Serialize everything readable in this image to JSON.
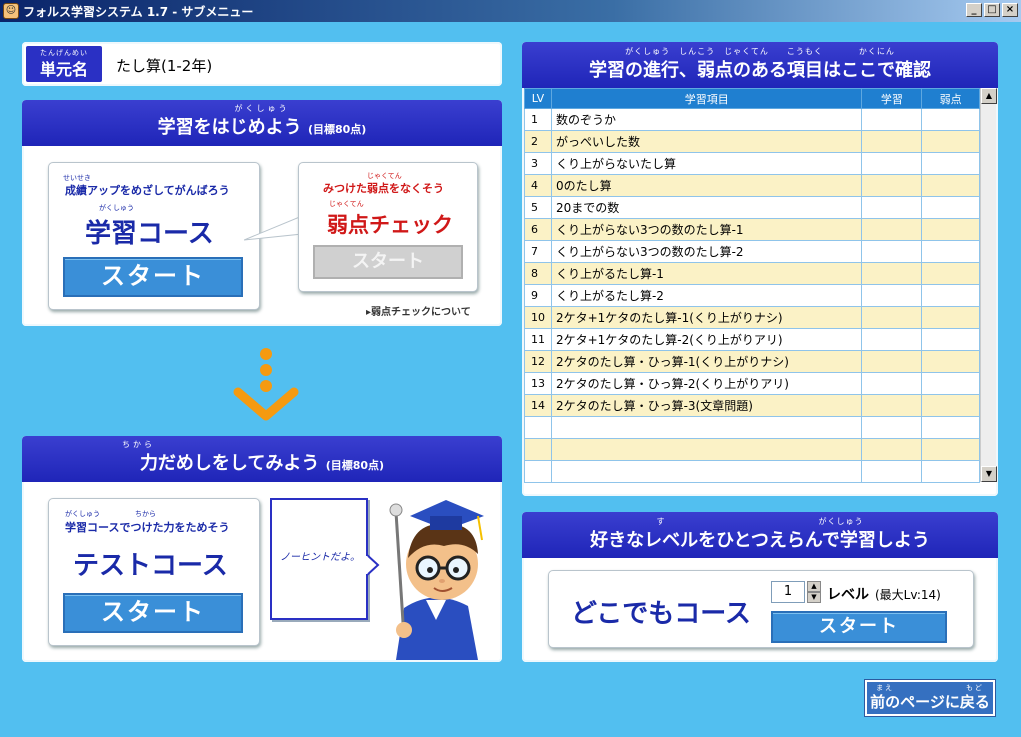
{
  "window": {
    "title": "フォルス学習システム 1.7 - サブメニュー",
    "minimize": "_",
    "maximize": "□",
    "close": "×"
  },
  "unit": {
    "label_ruby": "たんげんめい",
    "label": "単元名",
    "value": "たし算(1-2年)"
  },
  "study": {
    "title_ruby": "がくしゅう",
    "title": "学習をはじめよう",
    "title_sub": "(目標80点)",
    "course_sub_ruby": "せいせき",
    "course_sub": "成績アップをめざしてがんばろう",
    "course_ruby": "がくしゅう",
    "course_title": "学習コース",
    "course_start": "スタート",
    "weak_sub_ruby": "じゃくてん",
    "weak_sub": "みつけた弱点をなくそう",
    "weak_ruby": "じゃくてん",
    "weak_title": "弱点チェック",
    "weak_start": "スタート",
    "weak_link": "弱点チェックについて"
  },
  "test": {
    "title_ruby": "ちから",
    "title": "力だめしをしてみよう",
    "title_sub": "(目標80点)",
    "sub_ruby": "がくしゅう　　　　　ちから",
    "sub": "学習コースでつけた力をためそう",
    "course_title": "テストコース",
    "start": "スタート",
    "bubble": "ノーヒントだよ。"
  },
  "progress": {
    "title_ruby": "がくしゅう　しんこう　じゃくてん　　こうもく　　　　かくにん",
    "title": "学習の進行、弱点のある項目はここで確認",
    "headers": [
      "LV",
      "学習項目",
      "学習",
      "弱点"
    ],
    "rows": [
      [
        "1",
        "数のぞうか",
        "",
        ""
      ],
      [
        "2",
        "がっぺいした数",
        "",
        ""
      ],
      [
        "3",
        "くり上がらないたし算",
        "",
        ""
      ],
      [
        "4",
        "0のたし算",
        "",
        ""
      ],
      [
        "5",
        "20までの数",
        "",
        ""
      ],
      [
        "6",
        "くり上がらない3つの数のたし算-1",
        "",
        ""
      ],
      [
        "7",
        "くり上がらない3つの数のたし算-2",
        "",
        ""
      ],
      [
        "8",
        "くり上がるたし算-1",
        "",
        ""
      ],
      [
        "9",
        "くり上がるたし算-2",
        "",
        ""
      ],
      [
        "10",
        "2ケタ+1ケタのたし算-1(くり上がりナシ)",
        "",
        ""
      ],
      [
        "11",
        "2ケタ+1ケタのたし算-2(くり上がりアリ)",
        "",
        ""
      ],
      [
        "12",
        "2ケタのたし算・ひっ算-1(くり上がりナシ)",
        "",
        ""
      ],
      [
        "13",
        "2ケタのたし算・ひっ算-2(くり上がりアリ)",
        "",
        ""
      ],
      [
        "14",
        "2ケタのたし算・ひっ算-3(文章問題)",
        "",
        ""
      ],
      [
        "",
        "",
        "",
        ""
      ],
      [
        "",
        "",
        "",
        ""
      ],
      [
        "",
        "",
        "",
        ""
      ]
    ]
  },
  "anywhere": {
    "title_ruby": "す　　　　　　　　　　　　　　　　　がくしゅう",
    "title": "好きなレベルをひとつえらんで学習しよう",
    "course_title": "どこでもコース",
    "level_value": "1",
    "level_label": "レベル",
    "level_max": "(最大Lv:14)",
    "start": "スタート"
  },
  "back": {
    "ruby": "まえ　　　　　　　　もど",
    "label": "前のページに戻る"
  },
  "colors": {
    "bg": "#52bff0",
    "header": "#2a30c4",
    "start": "#3a8fd8",
    "accent_red": "#d01818",
    "arrow": "#f59a10"
  }
}
